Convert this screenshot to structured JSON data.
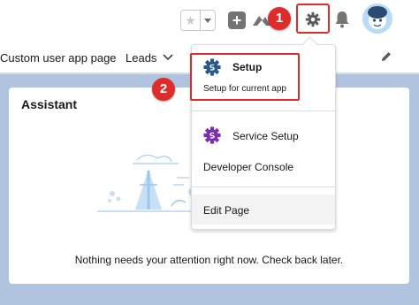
{
  "header": {
    "favorites_star": "★",
    "add_icon_glyph": "+",
    "icons": [
      "star-icon",
      "chevron-down-icon",
      "plus-icon",
      "trailhead-icon",
      "gear-icon",
      "bell-icon",
      "avatar"
    ]
  },
  "annotations": {
    "step1": "1",
    "step2": "2"
  },
  "nav": {
    "items": [
      {
        "label": "Custom user app page"
      },
      {
        "label": "Leads"
      }
    ]
  },
  "assistant": {
    "title": "Assistant",
    "empty_message": "Nothing needs your attention right now. Check back later."
  },
  "setup_menu": {
    "setup": {
      "label": "Setup",
      "description": "Setup for current app"
    },
    "service_setup": {
      "label": "Service Setup"
    },
    "developer_console": {
      "label": "Developer Console"
    },
    "edit_page": {
      "label": "Edit Page"
    }
  },
  "colors": {
    "annotation_red": "#e02b2b",
    "setup_icon_blue": "#2a5a8a",
    "service_icon_purple": "#7b2fb5",
    "main_background": "#b0c4df"
  }
}
